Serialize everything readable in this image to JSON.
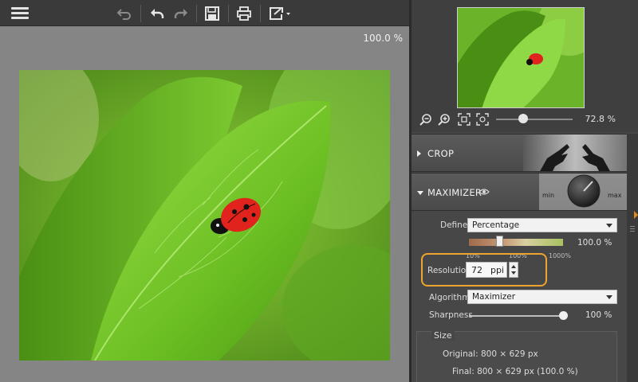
{
  "toolbar": {
    "menu_icon": "hamburger-menu-icon",
    "buttons": [
      "undo-all-icon",
      "undo-icon",
      "redo-icon",
      "save-icon",
      "print-icon",
      "export-icon"
    ]
  },
  "canvas": {
    "zoom_label": "100.0 %"
  },
  "navigator": {
    "zoom_value": "72.8 %",
    "zoom_level": 0.35,
    "icons": [
      "zoom-out-icon",
      "zoom-in-icon",
      "fit-to-window-icon",
      "actual-size-icon"
    ]
  },
  "sections": {
    "crop": {
      "title": "CROP"
    },
    "maximizer": {
      "title": "MAXIMIZER"
    }
  },
  "maximizer": {
    "define_label": "Define",
    "define_value": "Percentage",
    "percentage_value": "100.0 %",
    "percentage_level": 0.33,
    "ticks": [
      "10%",
      "100%",
      "1000%"
    ],
    "resolution_label": "Resolution",
    "resolution_value": "72",
    "resolution_unit": "ppi",
    "algorithm_label": "Algorithm",
    "algorithm_value": "Maximizer",
    "sharpness_label": "Sharpness",
    "sharpness_value": "100 %",
    "sharpness_level": 1.0,
    "size_title": "Size",
    "original_size": "Original: 800 × 629 px",
    "final_size": "Final: 800 × 629 px (100.0 %)"
  },
  "colors": {
    "accent_orange": "#f0a430",
    "panel_bg": "#474747",
    "canvas_bg": "#858585"
  }
}
